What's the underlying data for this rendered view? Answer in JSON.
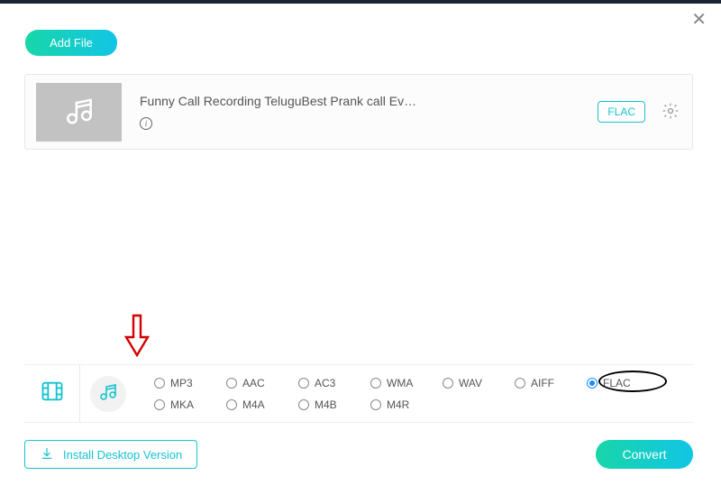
{
  "header": {
    "add_file_label": "Add File"
  },
  "file": {
    "title": "Funny Call Recording TeluguBest Prank call Ev…",
    "format_badge": "FLAC"
  },
  "tabs": {
    "video_active": false,
    "audio_active": true
  },
  "formats": {
    "row1": [
      "MP3",
      "AAC",
      "AC3",
      "WMA",
      "WAV",
      "AIFF",
      "FLAC"
    ],
    "row2": [
      "MKA",
      "M4A",
      "M4B",
      "M4R"
    ],
    "selected": "FLAC"
  },
  "footer": {
    "install_label": "Install Desktop Version",
    "convert_label": "Convert"
  }
}
